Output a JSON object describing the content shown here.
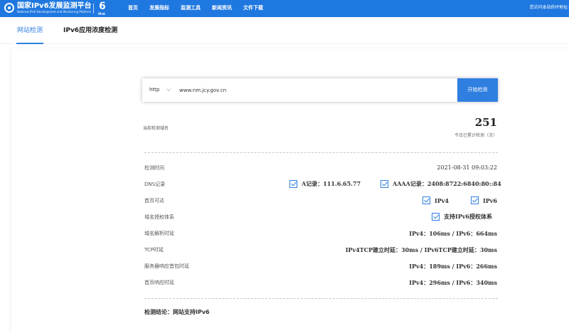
{
  "header": {
    "logo_title": "国家IPv6发展监测平台",
    "logo_subtitle": "National IPv6 Development and Monitoring Platform",
    "ipv6_badge": "IPv6",
    "nav": [
      "首页",
      "发展指标",
      "监测工具",
      "新闻资讯",
      "文件下载"
    ],
    "right_text": "您访问本站的IP地址:",
    "bg_color": "#1f78e0"
  },
  "tabs": [
    {
      "label": "网站检测",
      "active": true
    },
    {
      "label": "IPv6应用浓度检测",
      "active": false
    }
  ],
  "search": {
    "protocol": "http",
    "url": "www.nm.jcy.gov.cn",
    "button_label": "开始检测"
  },
  "stats": {
    "domain_label": "当前检测域名",
    "count": "251",
    "count_caption": "今日已累计检测（次）"
  },
  "rows": {
    "time": {
      "label": "检测时间",
      "value": "2021-08-31 09:03:22"
    },
    "dns": {
      "label": "DNS记录",
      "a": "A记录：111.6.65.77",
      "aaaa": "AAAA记录：2408:8722:6840:80::84"
    },
    "home": {
      "label": "首页可达",
      "ipv4": "IPv4",
      "ipv6": "IPv6"
    },
    "auth": {
      "label": "域名授权体系",
      "value": "支持IPv6授权体系"
    },
    "dnsdelay": {
      "label": "域名解析时延",
      "value": "IPv4：106ms / IPv6：664ms"
    },
    "tcp": {
      "label": "TCP时延",
      "value": "IPv4TCP建立时延：30ms / IPv6TCP建立时延：30ms"
    },
    "server": {
      "label": "服务器响应首包时延",
      "value": "IPv4：189ms / IPv6：266ms"
    },
    "page": {
      "label": "首页响应时延",
      "value": "IPv4：296ms / IPv6：340ms"
    }
  },
  "conclusion": "检测结论：网站支持IPv6",
  "accent_color": "#2f7fe0"
}
